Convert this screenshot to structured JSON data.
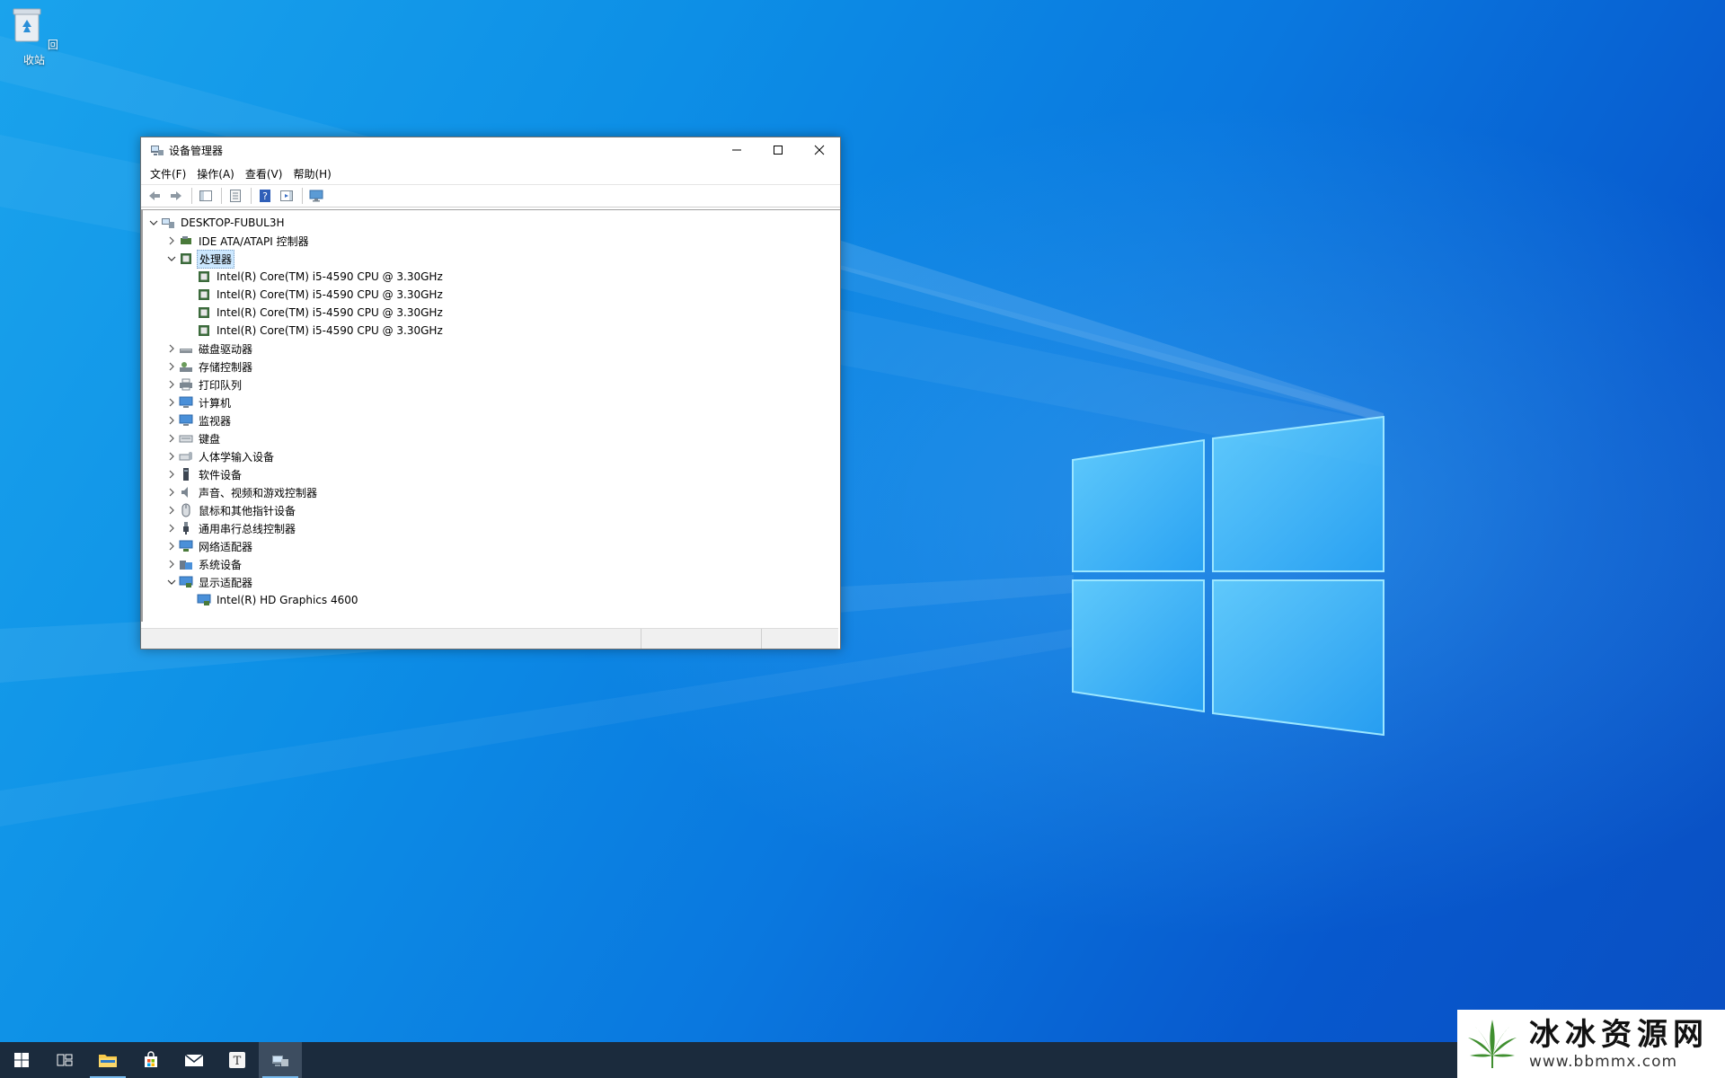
{
  "desktop": {
    "icons": [
      {
        "label": "回收站",
        "icon": "recycle-bin-icon"
      }
    ]
  },
  "window": {
    "title": "设备管理器",
    "controls": [
      "minimize-icon",
      "maximize-icon",
      "close-icon"
    ],
    "menu": [
      "文件(F)",
      "操作(A)",
      "查看(V)",
      "帮助(H)"
    ],
    "toolbar": [
      "back-arrow-icon",
      "forward-arrow-icon",
      "show-hide-tree-icon",
      "properties-icon",
      "help-icon",
      "action-pane-icon",
      "monitor-scan-icon"
    ],
    "tree": {
      "root": "DESKTOP-FUBUL3H",
      "nodes": [
        {
          "label": "IDE ATA/ATAPI 控制器",
          "expanded": false
        },
        {
          "label": "处理器",
          "expanded": true,
          "selected": true,
          "children": [
            "Intel(R) Core(TM) i5-4590 CPU @ 3.30GHz",
            "Intel(R) Core(TM) i5-4590 CPU @ 3.30GHz",
            "Intel(R) Core(TM) i5-4590 CPU @ 3.30GHz",
            "Intel(R) Core(TM) i5-4590 CPU @ 3.30GHz"
          ]
        },
        {
          "label": "磁盘驱动器",
          "expanded": false
        },
        {
          "label": "存储控制器",
          "expanded": false
        },
        {
          "label": "打印队列",
          "expanded": false
        },
        {
          "label": "计算机",
          "expanded": false
        },
        {
          "label": "监视器",
          "expanded": false
        },
        {
          "label": "键盘",
          "expanded": false
        },
        {
          "label": "人体学输入设备",
          "expanded": false
        },
        {
          "label": "软件设备",
          "expanded": false
        },
        {
          "label": "声音、视频和游戏控制器",
          "expanded": false
        },
        {
          "label": "鼠标和其他指针设备",
          "expanded": false
        },
        {
          "label": "通用串行总线控制器",
          "expanded": false
        },
        {
          "label": "网络适配器",
          "expanded": false
        },
        {
          "label": "系统设备",
          "expanded": false
        },
        {
          "label": "显示适配器",
          "expanded": true,
          "children": [
            "Intel(R) HD Graphics 4600"
          ]
        }
      ]
    }
  },
  "taskbar": {
    "items": [
      "start-icon",
      "task-view-icon",
      "file-explorer-icon",
      "store-icon",
      "mail-icon",
      "typora-icon",
      "device-manager-icon"
    ]
  },
  "watermark": {
    "text": "冰冰资源网",
    "url": "www.bbmmx.com"
  },
  "colors": {
    "selection": "#cce8ff",
    "taskbar": "#1b2b3d",
    "taskbar_active": "#3d4d60",
    "accent": "#76b9ed"
  }
}
